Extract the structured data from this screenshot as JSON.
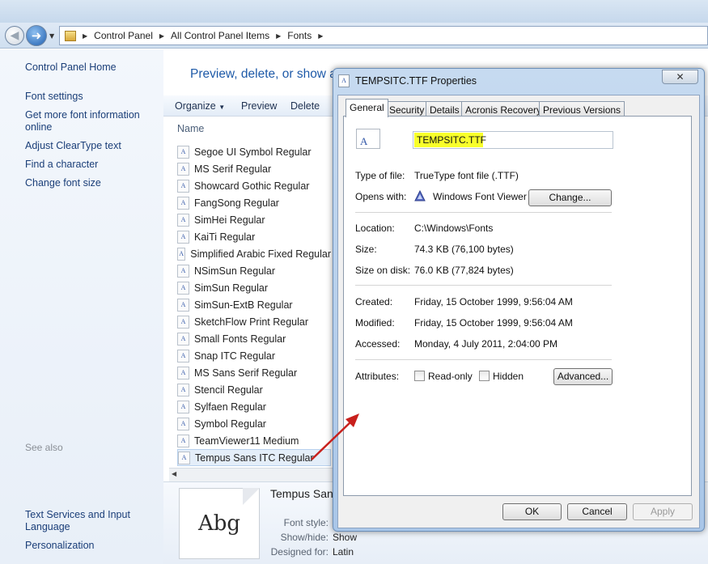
{
  "explorer": {
    "breadcrumb": [
      "Control Panel",
      "All Control Panel Items",
      "Fonts"
    ],
    "sidebar_links": [
      "Control Panel Home",
      "Font settings",
      "Get more font information online",
      "Adjust ClearType text",
      "Find a character",
      "Change font size"
    ],
    "see_also_label": "See also",
    "see_also_links": [
      "Text Services and Input Language",
      "Personalization"
    ],
    "headline": "Preview, delete, or show a",
    "toolbar": {
      "organize": "Organize",
      "preview": "Preview",
      "delete": "Delete"
    },
    "column_header": "Name",
    "font_list": [
      "Segoe UI Symbol Regular",
      "MS Serif Regular",
      "Showcard Gothic Regular",
      "FangSong Regular",
      "SimHei Regular",
      "KaiTi Regular",
      "Simplified Arabic Fixed Regular",
      "NSimSun Regular",
      "SimSun Regular",
      "SimSun-ExtB Regular",
      "SketchFlow Print Regular",
      "Small Fonts Regular",
      "Snap ITC Regular",
      "MS Sans Serif Regular",
      "Stencil Regular",
      "Sylfaen Regular",
      "Symbol Regular",
      "TeamViewer11 Medium",
      "Tempus Sans ITC Regular"
    ],
    "font_icon_glyph": "A",
    "details": {
      "title": "Tempus Sans",
      "preview_text": "Abg",
      "font_style_label": "Font style:",
      "show_hide_label": "Show/hide:",
      "show_hide_value": "Show",
      "designed_for_label": "Designed for:",
      "designed_for_value": "Latin"
    }
  },
  "dialog": {
    "title": "TEMPSITC.TTF Properties",
    "close_symbol": "✕",
    "tabs": [
      "General",
      "Security",
      "Details",
      "Acronis Recovery",
      "Previous Versions"
    ],
    "file_name": "TEMPSITC.TTF",
    "type_of_file": {
      "label": "Type of file:",
      "value": "TrueType font file (.TTF)"
    },
    "opens_with": {
      "label": "Opens with:",
      "value": "Windows Font Viewer",
      "button": "Change..."
    },
    "location": {
      "label": "Location:",
      "value": "C:\\Windows\\Fonts"
    },
    "size": {
      "label": "Size:",
      "value": "74.3 KB (76,100 bytes)"
    },
    "size_on_disk": {
      "label": "Size on disk:",
      "value": "76.0 KB (77,824 bytes)"
    },
    "created": {
      "label": "Created:",
      "value": "Friday, 15 October 1999, 9:56:04 AM"
    },
    "modified": {
      "label": "Modified:",
      "value": "Friday, 15 October 1999, 9:56:04 AM"
    },
    "accessed": {
      "label": "Accessed:",
      "value": "Monday, 4 July 2011, 2:04:00 PM"
    },
    "attributes": {
      "label": "Attributes:",
      "read_only": "Read-only",
      "hidden": "Hidden",
      "advanced": "Advanced..."
    },
    "buttons": {
      "ok": "OK",
      "cancel": "Cancel",
      "apply": "Apply"
    }
  },
  "colors": {
    "highlight": "#f8ff2a",
    "annotation_arrow": "#c8201c",
    "link": "#1a3e78"
  }
}
